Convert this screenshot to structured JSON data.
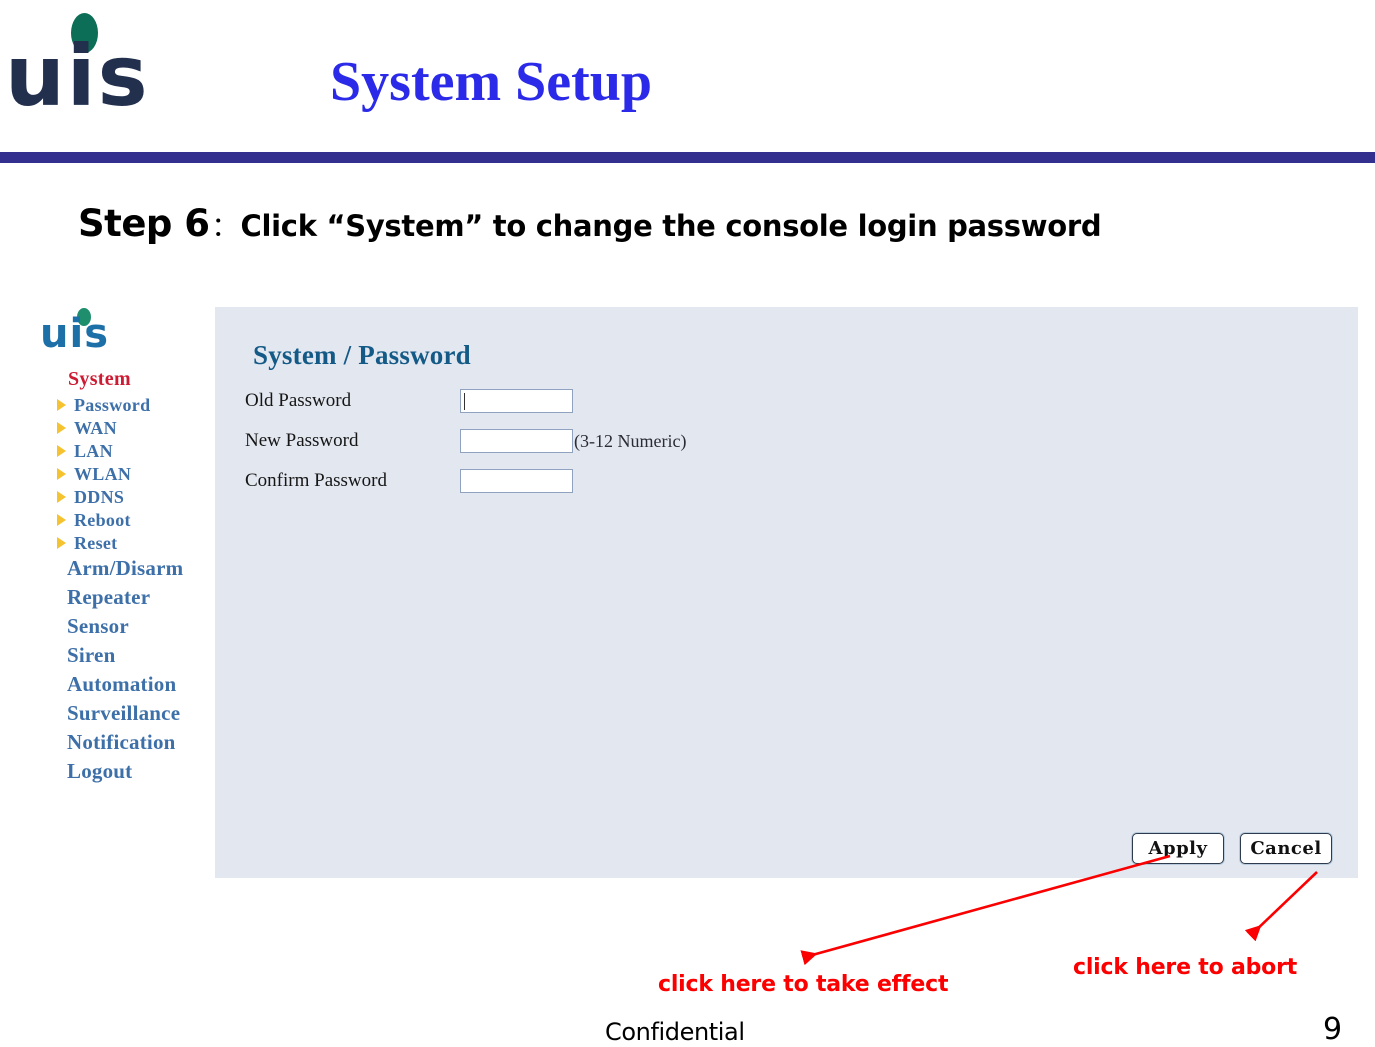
{
  "slide": {
    "title": "System Setup",
    "brand_logo_text": "uis",
    "step_label": "Step 6",
    "step_colon": "：",
    "step_text": "Click “System” to change the console login password",
    "footer_confidential": "Confidential",
    "page_number": "9",
    "colors": {
      "title_blue": "#2a2ae8",
      "header_rule": "#332f8f",
      "annotation_red": "#fb0000",
      "panel_bg": "#e3e7f0",
      "nav_link": "#3d6fa8",
      "nav_heading_red": "#cc1b33",
      "panel_heading": "#145a86",
      "bullet_yellow": "#f5c230",
      "logo_navy": "#22304e",
      "logo_green": "#0c6e57"
    }
  },
  "router_ui": {
    "logo_text": "uis",
    "nav_heading": "System",
    "nav_sub_items": [
      {
        "label": "Password",
        "icon": "triangle-right-icon"
      },
      {
        "label": "WAN",
        "icon": "triangle-right-icon"
      },
      {
        "label": "LAN",
        "icon": "triangle-right-icon"
      },
      {
        "label": "WLAN",
        "icon": "triangle-right-icon"
      },
      {
        "label": "DDNS",
        "icon": "triangle-right-icon"
      },
      {
        "label": "Reboot",
        "icon": "triangle-right-icon"
      },
      {
        "label": "Reset",
        "icon": "triangle-right-icon"
      }
    ],
    "nav_main_items": [
      {
        "label": "Arm/Disarm"
      },
      {
        "label": "Repeater"
      },
      {
        "label": "Sensor"
      },
      {
        "label": "Siren"
      },
      {
        "label": "Automation"
      },
      {
        "label": "Surveillance"
      },
      {
        "label": "Notification"
      },
      {
        "label": "Logout"
      }
    ],
    "panel": {
      "title": "System / Password",
      "fields": [
        {
          "label": "Old Password",
          "value": "",
          "hint": ""
        },
        {
          "label": "New Password",
          "value": "",
          "hint": "(3-12 Numeric)"
        },
        {
          "label": "Confirm Password",
          "value": "",
          "hint": ""
        }
      ],
      "buttons": {
        "apply": "Apply",
        "cancel": "Cancel"
      }
    }
  },
  "annotations": [
    {
      "text": "click here to take effect",
      "points_to": "apply-button"
    },
    {
      "text": "click here to abort",
      "points_to": "cancel-button"
    }
  ]
}
